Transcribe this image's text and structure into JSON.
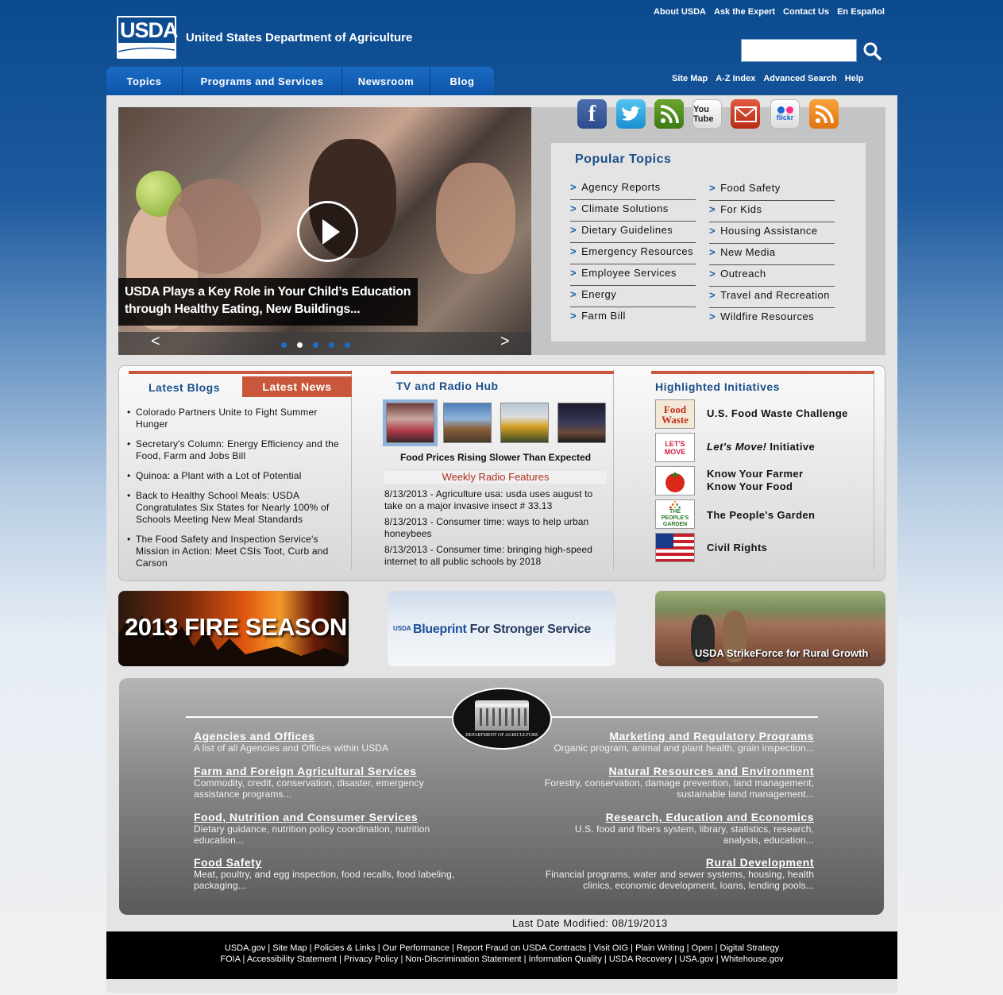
{
  "header": {
    "logo_text": "USDA",
    "agency_name": "United States Department of Agriculture",
    "top_links": [
      "About USDA",
      "Ask the Expert",
      "Contact Us",
      "En Español"
    ],
    "search_placeholder": "",
    "sub_links": [
      "Site Map",
      "A-Z Index",
      "Advanced Search",
      "Help"
    ]
  },
  "nav": [
    "Topics",
    "Programs and Services",
    "Newsroom",
    "Blog"
  ],
  "hero": {
    "caption_line1": "USDA Plays a Key Role in Your Child’s Education",
    "caption_line2": "through Healthy Eating, New Buildings...",
    "prev": "<",
    "next": ">",
    "slide_count": 5,
    "active_slide": 2
  },
  "social": {
    "icons": [
      "facebook-icon",
      "twitter-icon",
      "blogger-icon",
      "youtube-icon",
      "email-icon",
      "flickr-icon",
      "rss-icon"
    ],
    "youtube_label": "You Tube",
    "flickr_label": "flickr"
  },
  "popular": {
    "title": "Popular Topics",
    "left": [
      "Agency Reports",
      "Climate Solutions",
      "Dietary Guidelines",
      "Emergency Resources",
      "Employee Services",
      "Energy",
      "Farm Bill"
    ],
    "right": [
      "Food Safety",
      "For Kids",
      "Housing Assistance",
      "New Media",
      "Outreach",
      "Travel and Recreation",
      "Wildfire Resources"
    ],
    "marker": ">"
  },
  "news": {
    "tab_blogs": "Latest Blogs",
    "tab_news": "Latest News",
    "items": [
      "Colorado Partners Unite to Fight Summer Hunger",
      "Secretary's Column: Energy Efficiency and the Food, Farm and Jobs Bill",
      "Quinoa: a Plant with a Lot of Potential",
      "Back to Healthy School Meals: USDA Congratulates Six States for Nearly 100% of Schools Meeting New Meal Standards",
      "The Food Safety and Inspection Service's Mission in Action: Meet CSIs Toot, Curb and Carson"
    ]
  },
  "tv": {
    "title": "TV and Radio Hub",
    "caption": "Food Prices Rising Slower Than Expected",
    "radio_header": "Weekly Radio Features",
    "radio_items": [
      "8/13/2013 - Agriculture usa: usda uses august to take on a major invasive insect # 33.13",
      "8/13/2013 - Consumer time: ways to help urban honeybees",
      "8/13/2013 - Consumer time: bringing high-speed internet to all public schools by 2018"
    ]
  },
  "initiatives": {
    "title": "Highlighted Initiatives",
    "icon_food_waste": "Food Waste",
    "icon_lets_move": "LET'S MOVE",
    "icon_garden": "THE PEOPLE'S GARDEN",
    "food_waste": "U.S. Food Waste Challenge",
    "lets_move_em": "Let's Move!",
    "lets_move_rest": " Initiative",
    "know_farmer_1": "Know Your Farmer",
    "know_farmer_2": "Know Your Food",
    "peoples_garden": "The People's Garden",
    "civil_rights": "Civil Rights"
  },
  "promos": {
    "fire": "2013 FIRE SEASON",
    "blueprint_usda": "USDA",
    "blueprint_1": "Blueprint",
    "blueprint_2": " For Stronger Service",
    "strikeforce": "USDA StrikeForce for Rural Growth"
  },
  "agencies": {
    "seal_text": "DEPARTMENT OF AGRICULTURE",
    "left": [
      {
        "title": "Agencies and Offices",
        "desc": "A list of all Agencies and Offices within USDA"
      },
      {
        "title": "Farm and Foreign Agricultural Services",
        "desc": "Commodity, credit, conservation, disaster, emergency assistance programs..."
      },
      {
        "title": "Food, Nutrition and Consumer Services",
        "desc": "Dietary guidance, nutrition policy coordination, nutrition education..."
      },
      {
        "title": "Food Safety",
        "desc": "Meat, poultry, and egg inspection, food recalls, food labeling, packaging..."
      }
    ],
    "right": [
      {
        "title": "Marketing and Regulatory Programs",
        "desc": "Organic program, animal and plant health, grain inspection..."
      },
      {
        "title": "Natural Resources and Environment",
        "desc": "Forestry, conservation, damage prevention, land management, sustainable land management..."
      },
      {
        "title": "Research, Education and Economics",
        "desc": "U.S. food and fibers system, library, statistics, research, analysis, education..."
      },
      {
        "title": "Rural Development",
        "desc": "Financial programs, water and sewer systems, housing, health clinics, economic development, loans, lending pools..."
      }
    ]
  },
  "modified": "Last Date Modified: 08/19/2013",
  "footer": {
    "line1": [
      "USDA.gov",
      "Site Map",
      "Policies & Links",
      "Our Performance",
      "Report Fraud on USDA Contracts",
      "Visit OIG",
      "Plain Writing",
      "Open",
      "Digital Strategy"
    ],
    "line2": [
      "FOIA",
      "Accessibility Statement",
      "Privacy Policy",
      "Non-Discrimination Statement",
      "Information Quality",
      "USDA Recovery",
      "USA.gov",
      "Whitehouse.gov"
    ]
  },
  "colors": {
    "brand_blue": "#0a4a8f",
    "accent_red": "#c9573b",
    "heading_blue": "#1a4f8a"
  }
}
